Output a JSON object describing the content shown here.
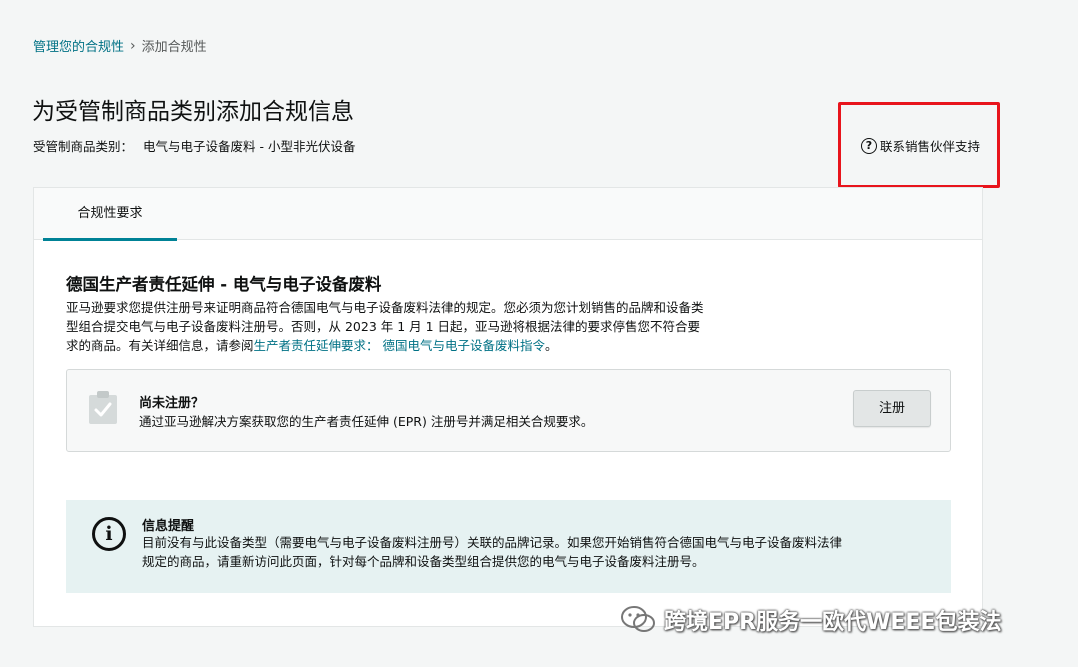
{
  "breadcrumb": {
    "parent": "管理您的合规性",
    "separator": "›",
    "current": "添加合规性"
  },
  "header": {
    "title": "为受管制商品类别添加合规信息",
    "category_label": "受管制商品类别：",
    "category_value": "电气与电子设备废料 - 小型非光伏设备",
    "support_link": "联系销售伙伴支持",
    "support_icon": "question-circle-icon"
  },
  "tabs": [
    {
      "label": "合规性要求",
      "active": true
    }
  ],
  "section": {
    "title": "德国生产者责任延伸 - 电气与电子设备废料",
    "desc_line1": "亚马逊要求您提供注册号来证明商品符合德国电气与电子设备废料法律的规定。您必须为您计划销售的品牌和设备类",
    "desc_line2": "型组合提交电气与电子设备废料注册号。否则，从 2023 年 1 月 1 日起，亚马逊将根据法律的要求停售您不符合要",
    "desc_line3_prefix": "求的商品。有关详细信息，请参阅",
    "desc_link": "生产者责任延伸要求：  德国电气与电子设备废料指令",
    "desc_line3_suffix": "。"
  },
  "register": {
    "icon": "clipboard-check-icon",
    "title": "尚未注册？",
    "text": "通过亚马逊解决方案获取您的生产者责任延伸 (EPR) 注册号并满足相关合规要求。",
    "button_label": "注册"
  },
  "info": {
    "icon": "info-icon",
    "title": "信息提醒",
    "text_line1": "目前没有与此设备类型（需要电气与电子设备废料注册号）关联的品牌记录。如果您开始销售符合德国电气与电子设备废料法律",
    "text_line2": "规定的商品，请重新访问此页面，针对每个品牌和设备类型组合提供您的电气与电子设备废料注册号。"
  },
  "watermark": {
    "text": "跨境EPR服务一欧代WEEE包装法",
    "icon": "wechat-icon"
  },
  "colors": {
    "accent": "#008296",
    "link": "#007185",
    "highlight_box": "#e8141c",
    "info_bg": "#e6f2f2"
  }
}
